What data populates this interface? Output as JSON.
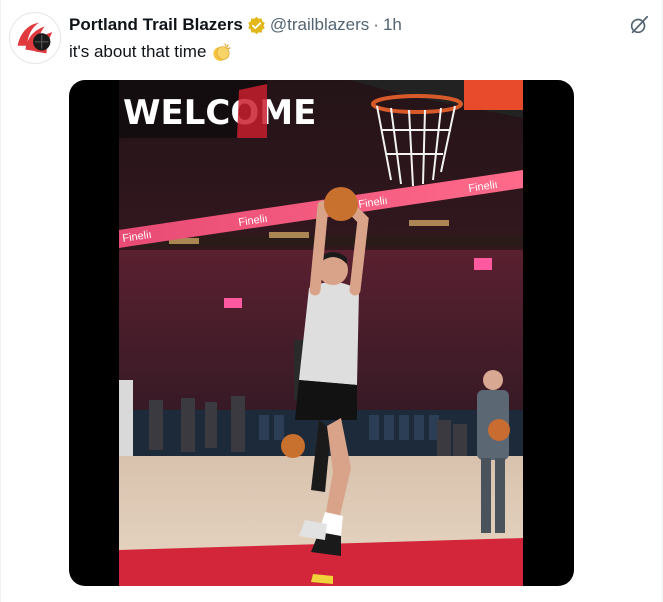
{
  "post": {
    "author_name": "Portland Trail Blazers",
    "handle": "@trailblazers",
    "separator": "·",
    "timestamp": "1h",
    "text": "it's about that time",
    "text_emoji_icon": "clapping-hands-icon",
    "verified_icon": "verified-badge-icon",
    "menu_icon": "grok-icon",
    "verified_color": "#e2b719",
    "brand_color": "#e03a3e"
  },
  "media": {
    "type": "video",
    "scene": {
      "welcome_sign": "WELCOME",
      "ribbon_text_1": "Fineliı",
      "ribbon_text_2": "Fineliı",
      "ribbon_text_3": "Fineliı",
      "ribbon_text_4": "Fineliı"
    }
  }
}
